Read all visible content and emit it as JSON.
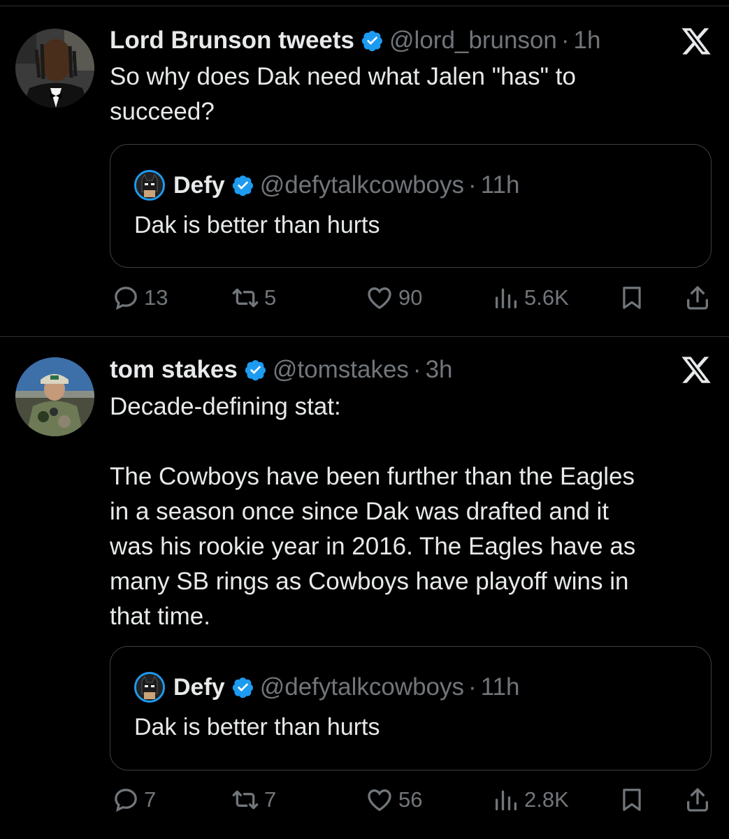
{
  "colors": {
    "background": "#000000",
    "text": "#e7e9ea",
    "muted": "#71767b",
    "verified": "#1d9bf0",
    "divider": "#2f3336"
  },
  "tweets": [
    {
      "name": "Lord Brunson tweets",
      "handle": "@lord_brunson",
      "dot": "·",
      "time": "1h",
      "text": "So why does Dak need what Jalen \"has\" to\nsucceed?",
      "quote": {
        "name": "Defy",
        "handle": "@defytalkcowboys",
        "dot": "·",
        "time": "11h",
        "text": "Dak is better than hurts"
      },
      "stats": {
        "replies": "13",
        "retweets": "5",
        "likes": "90",
        "views": "5.6K"
      },
      "icons": [
        "verified-badge-icon",
        "x-logo-icon",
        "reply-icon",
        "retweet-icon",
        "like-icon",
        "views-icon",
        "bookmark-icon",
        "share-icon"
      ]
    },
    {
      "name": "tom stakes",
      "handle": "@tomstakes",
      "dot": "·",
      "time": "3h",
      "text": "Decade-defining stat:\n\nThe Cowboys have been further than the Eagles\nin a season once since Dak was drafted and it\nwas his rookie year in 2016. The Eagles have as\nmany SB rings as Cowboys have playoff wins in\nthat time.",
      "quote": {
        "name": "Defy",
        "handle": "@defytalkcowboys",
        "dot": "·",
        "time": "11h",
        "text": "Dak is better than hurts"
      },
      "stats": {
        "replies": "7",
        "retweets": "7",
        "likes": "56",
        "views": "2.8K"
      },
      "icons": [
        "verified-badge-icon",
        "x-logo-icon",
        "reply-icon",
        "retweet-icon",
        "like-icon",
        "views-icon",
        "bookmark-icon",
        "share-icon"
      ]
    }
  ]
}
